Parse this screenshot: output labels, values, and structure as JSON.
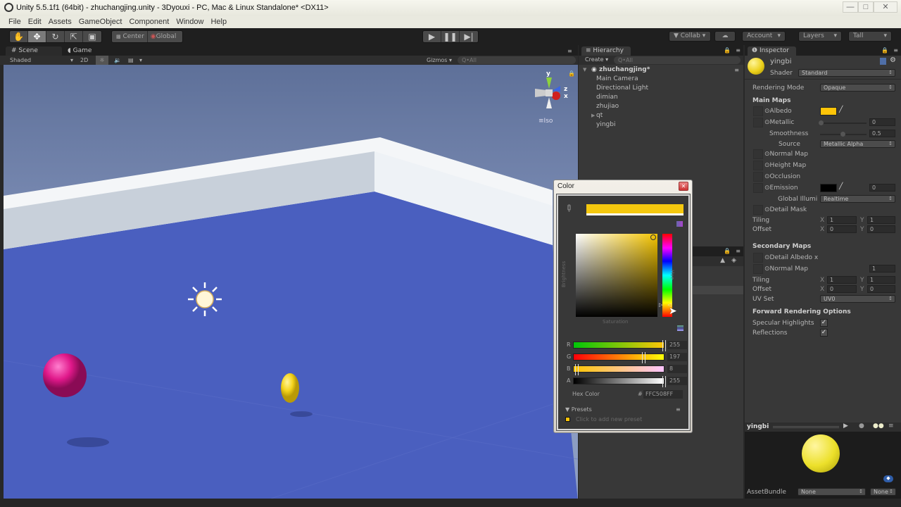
{
  "window": {
    "title": "Unity 5.5.1f1 (64bit) - zhuchangjing.unity - 3Dyouxi - PC, Mac & Linux Standalone* <DX11>",
    "controls": [
      "minimize",
      "maximize",
      "close"
    ]
  },
  "menu": [
    "File",
    "Edit",
    "Assets",
    "GameObject",
    "Component",
    "Window",
    "Help"
  ],
  "toolbar": {
    "tools": [
      "hand-tool",
      "move-tool",
      "rotate-tool",
      "scale-tool",
      "rect-tool"
    ],
    "active_tool": "move-tool",
    "pivot_mode": "Center",
    "pivot_rotation": "Global",
    "play_controls": [
      "play",
      "pause",
      "step"
    ],
    "collab_label": "Collab",
    "account_label": "Account",
    "layers_label": "Layers",
    "layout_label": "Tall"
  },
  "scene": {
    "tabs": [
      "Scene",
      "Game"
    ],
    "active_tab": "Scene",
    "draw_mode": "Shaded",
    "mode_2d": "2D",
    "gizmos_label": "Gizmos",
    "search_placeholder": "All",
    "gizmo_axes": {
      "y": "y",
      "z": "z",
      "x": "x"
    },
    "projection_label": "Iso"
  },
  "hierarchy": {
    "tab_label": "Hierarchy",
    "create_label": "Create",
    "search_placeholder": "All",
    "scene_name": "zhuchangjing*",
    "items": [
      {
        "label": "Main Camera",
        "has_children": false
      },
      {
        "label": "Directional Light",
        "has_children": false
      },
      {
        "label": "dimian",
        "has_children": false
      },
      {
        "label": "zhujiao",
        "has_children": false
      },
      {
        "label": "qt",
        "has_children": true
      },
      {
        "label": "yingbi",
        "has_children": false
      }
    ]
  },
  "inspector": {
    "tab_label": "Inspector",
    "object_name": "yingbi",
    "shader_label": "Shader",
    "shader_value": "Standard",
    "rendering_mode_label": "Rendering Mode",
    "rendering_mode_value": "Opaque",
    "main_maps_header": "Main Maps",
    "albedo_label": "Albedo",
    "albedo_color": "#FFC508",
    "metallic_label": "Metallic",
    "metallic_value": "0",
    "smoothness_label": "Smoothness",
    "smoothness_value": "0.5",
    "source_label": "Source",
    "source_value": "Metallic Alpha",
    "normal_map_label": "Normal Map",
    "height_map_label": "Height Map",
    "occlusion_label": "Occlusion",
    "emission_label": "Emission",
    "emission_color": "#000000",
    "emission_value": "0",
    "global_illum_label": "Global Illumi",
    "global_illum_value": "Realtime",
    "detail_mask_label": "Detail Mask",
    "tiling_label": "Tiling",
    "offset_label": "Offset",
    "main_tiling": {
      "x": "1",
      "y": "1"
    },
    "main_offset": {
      "x": "0",
      "y": "0"
    },
    "secondary_maps_header": "Secondary Maps",
    "detail_albedo_label": "Detail Albedo x",
    "detail_normal_label": "Normal Map",
    "detail_normal_value": "1",
    "secondary_tiling": {
      "x": "1",
      "y": "1"
    },
    "secondary_offset": {
      "x": "0",
      "y": "0"
    },
    "uv_set_label": "UV Set",
    "uv_set_value": "UV0",
    "forward_header": "Forward Rendering Options",
    "specular_label": "Specular Highlights",
    "specular_checked": true,
    "reflections_label": "Reflections",
    "reflections_checked": true,
    "axis_x": "X",
    "axis_y": "Y"
  },
  "preview": {
    "title": "yingbi",
    "assetbundle_label": "AssetBundle",
    "assetbundle_value": "None",
    "variant_value": "None"
  },
  "color_picker": {
    "title": "Color",
    "current_color": "#F5C80E",
    "brightness_label": "Brightness",
    "saturation_label": "Saturation",
    "hue_label": "Hue",
    "channels": [
      {
        "name": "R",
        "value": "255",
        "fraction": 1.0
      },
      {
        "name": "G",
        "value": "197",
        "fraction": 0.773
      },
      {
        "name": "B",
        "value": "8",
        "fraction": 0.031
      },
      {
        "name": "A",
        "value": "255",
        "fraction": 1.0
      }
    ],
    "hex_label": "Hex Color",
    "hex_prefix": "#",
    "hex_value": "FFC508FF",
    "presets_label": "Presets",
    "add_preset_text": "Click to add new preset"
  }
}
